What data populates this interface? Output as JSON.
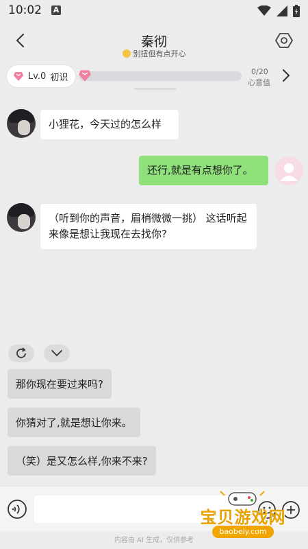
{
  "status_bar": {
    "time": "10:02",
    "a_glyph": "A"
  },
  "header": {
    "title": "秦彻",
    "subtitle": "别扭但有点开心",
    "icons": {
      "back": "chevron-left-icon",
      "settings": "hexagon-settings-icon"
    }
  },
  "level": {
    "label": "Lv.0",
    "stage": "初识",
    "progress_current": 0,
    "progress_max": 20,
    "progress_text": "0/20",
    "progress_label": "心意值",
    "progress_fraction": 0.0
  },
  "messages": [
    {
      "from": "ai",
      "text": "小狸花，今天过的怎么样"
    },
    {
      "from": "user",
      "text": "还行,就是有点想你了。"
    },
    {
      "from": "ai",
      "text": "（听到你的声音，眉梢微微一挑） 这话听起来像是想让我现在去找你?"
    }
  ],
  "suggestions": [
    "那你现在要过来吗?",
    "你猜对了,就是想让你来。",
    "（笑）是又怎么样,你来不来?"
  ],
  "input": {
    "placeholder": ""
  },
  "disclaimer": "内容由 AI 生成，仅供参考",
  "watermark": {
    "text": "宝贝游戏网",
    "url": "baobeiy.com"
  },
  "colors": {
    "user_bubble": "#8fe07a",
    "ai_bubble": "#ffffff",
    "gem": "#f27fa0",
    "background": "#ececec"
  }
}
